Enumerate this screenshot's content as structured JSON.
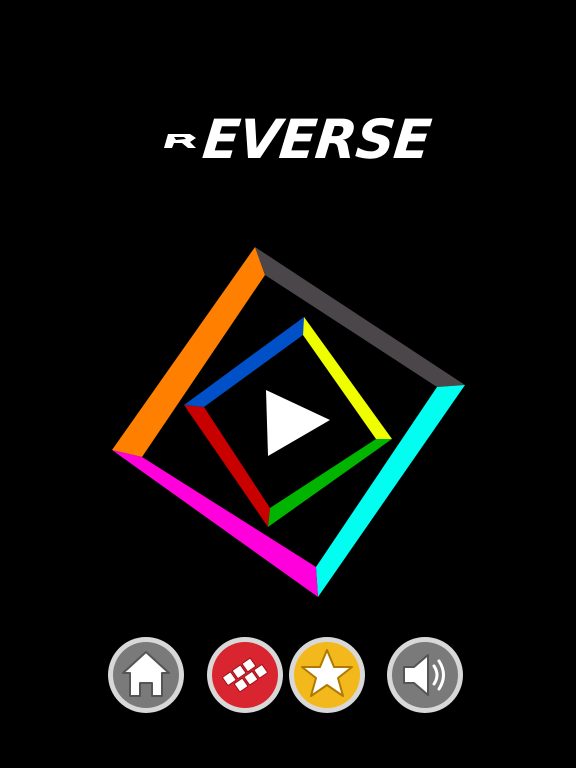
{
  "title": {
    "text": "EVERSE",
    "color": "#ffffff"
  },
  "board": {
    "outer_ring_colors": {
      "top_left": "#ff7f00",
      "top_right": "#4a464a",
      "bottom_right": "#00fff0",
      "bottom_left": "#ff00dc"
    },
    "inner_ring_colors": {
      "top_left": "#0050c8",
      "top_right": "#f0ff00",
      "bottom_right": "#00b400",
      "bottom_left": "#c80000"
    },
    "center_icon": "play-icon"
  },
  "buttons": [
    {
      "id": "home",
      "icon": "home-icon",
      "color": "#7a7a7a"
    },
    {
      "id": "more-games",
      "icon": "tiles-icon",
      "color": "#d8252f"
    },
    {
      "id": "rate",
      "icon": "star-icon",
      "color": "#f2b81c"
    },
    {
      "id": "sound",
      "icon": "speaker-icon",
      "color": "#7a7a7a"
    }
  ]
}
